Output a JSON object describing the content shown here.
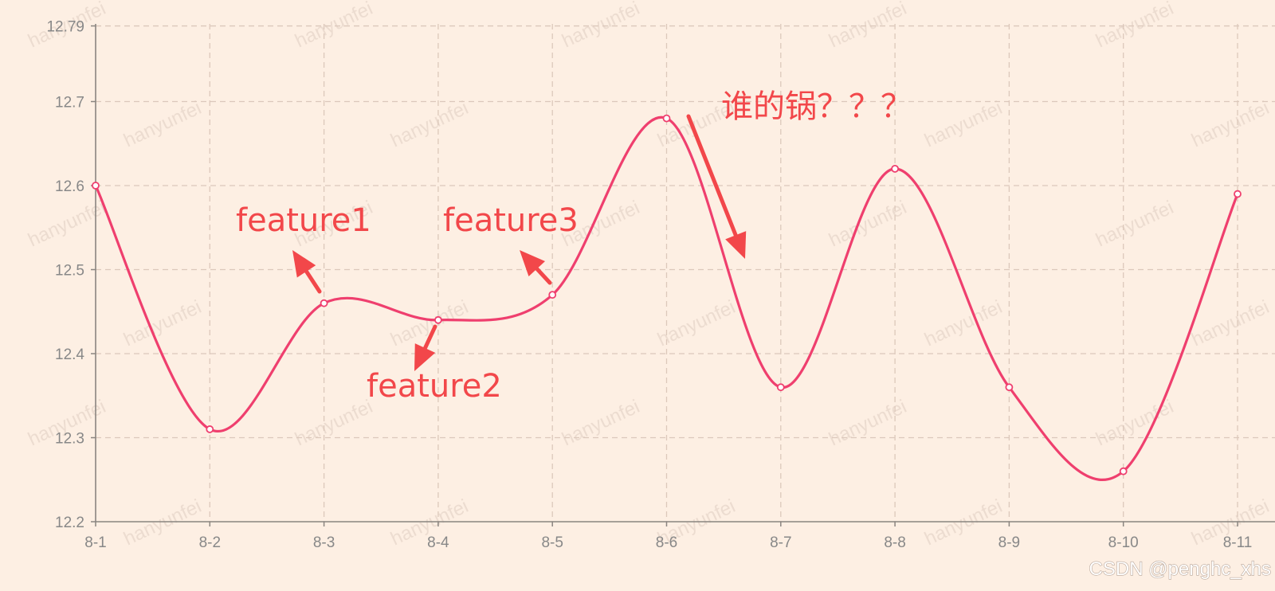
{
  "chart_data": {
    "type": "line",
    "smooth": true,
    "categories": [
      "8-1",
      "8-2",
      "8-3",
      "8-4",
      "8-5",
      "8-6",
      "8-7",
      "8-8",
      "8-9",
      "8-10",
      "8-11"
    ],
    "values": [
      12.6,
      12.31,
      12.46,
      12.44,
      12.47,
      12.68,
      12.36,
      12.62,
      12.36,
      12.26,
      12.59
    ],
    "ylim": [
      12.2,
      12.79
    ],
    "yticks": [
      12.2,
      12.3,
      12.4,
      12.5,
      12.6,
      12.7,
      12.79
    ],
    "ytick_labels": [
      "12.2",
      "12.3",
      "12.4",
      "12.5",
      "12.6",
      "12.7",
      "12.79"
    ],
    "grid": true,
    "line_color": "#ef3f6e",
    "background_color": "#fdefe3",
    "annotations": [
      {
        "text": "feature1",
        "near_category": "8-3"
      },
      {
        "text": "feature2",
        "near_category": "8-4"
      },
      {
        "text": "feature3",
        "near_category": "8-5"
      },
      {
        "text": "谁的锅？？？",
        "near_category": "8-6"
      }
    ],
    "annotation_color": "#f2474a"
  },
  "watermark": "hanyunfei",
  "credit": "CSDN @penghc_xhs"
}
